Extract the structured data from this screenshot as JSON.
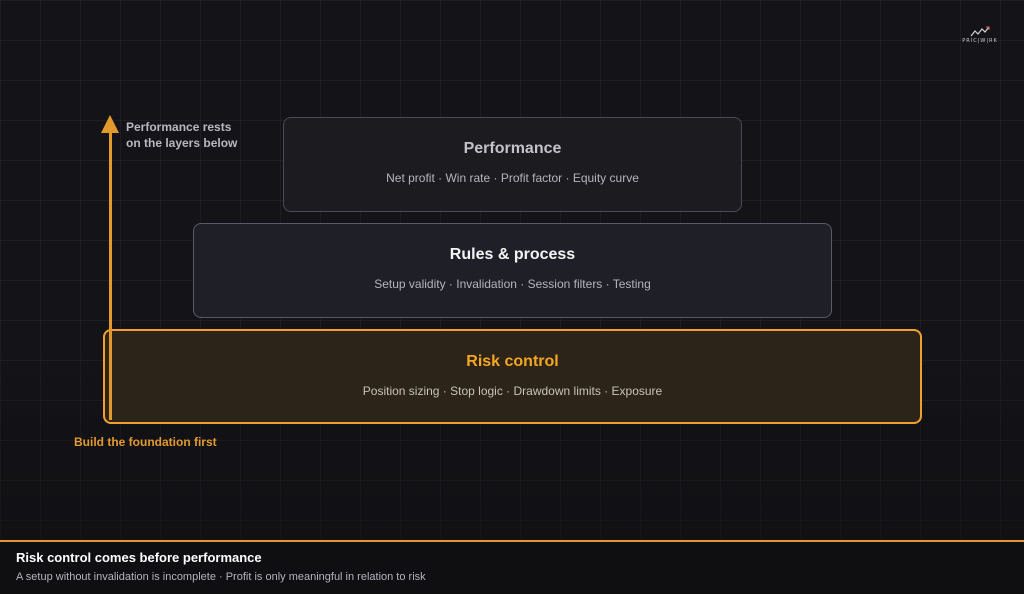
{
  "logo": {
    "text": "PRIC|W|RK",
    "icon": "line-chart-icon"
  },
  "layers": {
    "top": {
      "title": "Performance",
      "subtitle": "Net profit · Win rate · Profit factor · Equity curve"
    },
    "middle": {
      "title": "Rules & process",
      "subtitle": "Setup validity · Invalidation · Session filters · Testing"
    },
    "base": {
      "title": "Risk control",
      "subtitle": "Position sizing · Stop logic · Drawdown limits · Exposure"
    }
  },
  "arrow": {
    "note_line1": "Performance rests",
    "note_line2": "on the layers below",
    "foundation_label": "Build the foundation first"
  },
  "footer": {
    "title": "Risk control comes before performance",
    "subtitle": "A setup without invalidation is incomplete · Profit is only meaningful in relation to risk"
  },
  "colors": {
    "accent": "#f5a623",
    "background": "#141418",
    "base_fill": "#2c2418"
  }
}
